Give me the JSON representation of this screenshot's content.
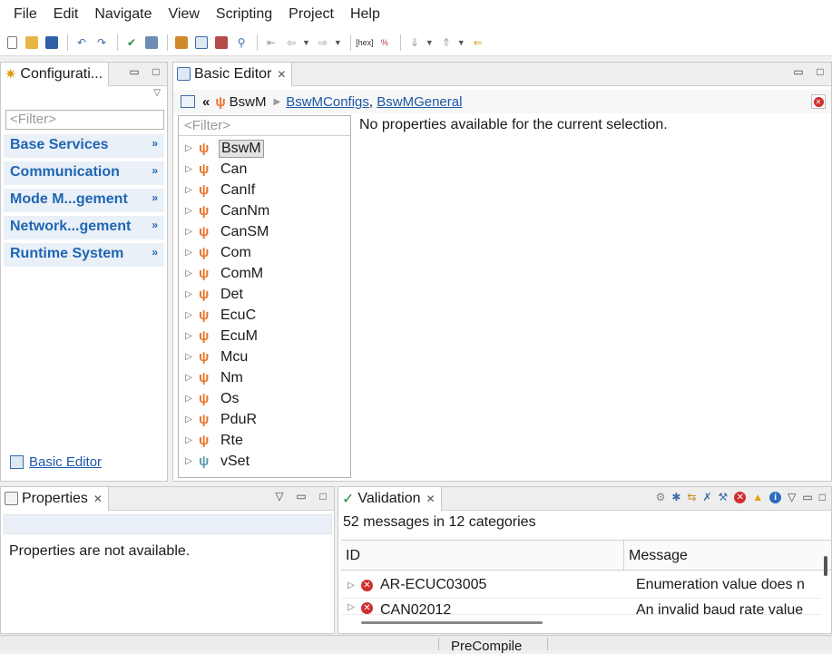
{
  "menu": [
    "File",
    "Edit",
    "Navigate",
    "View",
    "Scripting",
    "Project",
    "Help"
  ],
  "config_panel": {
    "title": "Configurati...",
    "filter_placeholder": "<Filter>",
    "categories": [
      "Base Services",
      "Communication",
      "Mode M...gement",
      "Network...gement",
      "Runtime System"
    ],
    "basic_editor_link": "Basic Editor"
  },
  "editor": {
    "tab_title": "Basic Editor",
    "breadcrumb": {
      "root": "BswM",
      "link1": "BswMConfigs",
      "separator": ", ",
      "link2": "BswMGeneral"
    },
    "filter_placeholder": "<Filter>",
    "tree": [
      {
        "label": "BswM",
        "selected": true,
        "color": "#e8762c"
      },
      {
        "label": "Can",
        "color": "#e8762c"
      },
      {
        "label": "CanIf",
        "color": "#e8762c"
      },
      {
        "label": "CanNm",
        "color": "#e8762c"
      },
      {
        "label": "CanSM",
        "color": "#e8762c"
      },
      {
        "label": "Com",
        "color": "#e8762c"
      },
      {
        "label": "ComM",
        "color": "#e8762c"
      },
      {
        "label": "Det",
        "color": "#e8762c"
      },
      {
        "label": "EcuC",
        "color": "#e8762c"
      },
      {
        "label": "EcuM",
        "color": "#e8762c"
      },
      {
        "label": "Mcu",
        "color": "#e8762c"
      },
      {
        "label": "Nm",
        "color": "#e8762c"
      },
      {
        "label": "Os",
        "color": "#e8762c"
      },
      {
        "label": "PduR",
        "color": "#e8762c"
      },
      {
        "label": "Rte",
        "color": "#e8762c"
      },
      {
        "label": "vSet",
        "color": "#5a9fb0"
      }
    ],
    "no_properties_message": "No properties available for the current selection."
  },
  "properties": {
    "tab_title": "Properties",
    "empty_message": "Properties are not available."
  },
  "validation": {
    "tab_title": "Validation",
    "summary": "52 messages in 12 categories",
    "columns": {
      "id": "ID",
      "message": "Message"
    },
    "rows": [
      {
        "id": "AR-ECUC03005",
        "message": "Enumeration value does n"
      },
      {
        "id": "CAN02012",
        "message": "An invalid baud rate value"
      }
    ]
  },
  "statusbar": {
    "text": "PreCompile"
  }
}
